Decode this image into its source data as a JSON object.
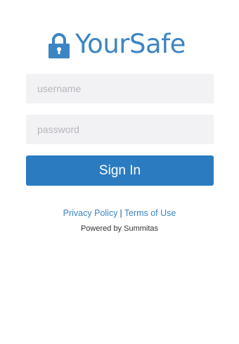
{
  "brand": {
    "name": "YourSafe",
    "color": "#3c85c4",
    "icon": "lock-icon"
  },
  "login_form": {
    "username_placeholder": "username",
    "username_value": "",
    "password_placeholder": "password",
    "password_value": "",
    "field_background": "#f2f2f5",
    "signin_label": "Sign In",
    "signin_color": "#2b7bc1"
  },
  "footer": {
    "privacy_label": "Privacy Policy",
    "separator": "|",
    "terms_label": "Terms of Use",
    "powered_by": "Powered by Summitas"
  }
}
